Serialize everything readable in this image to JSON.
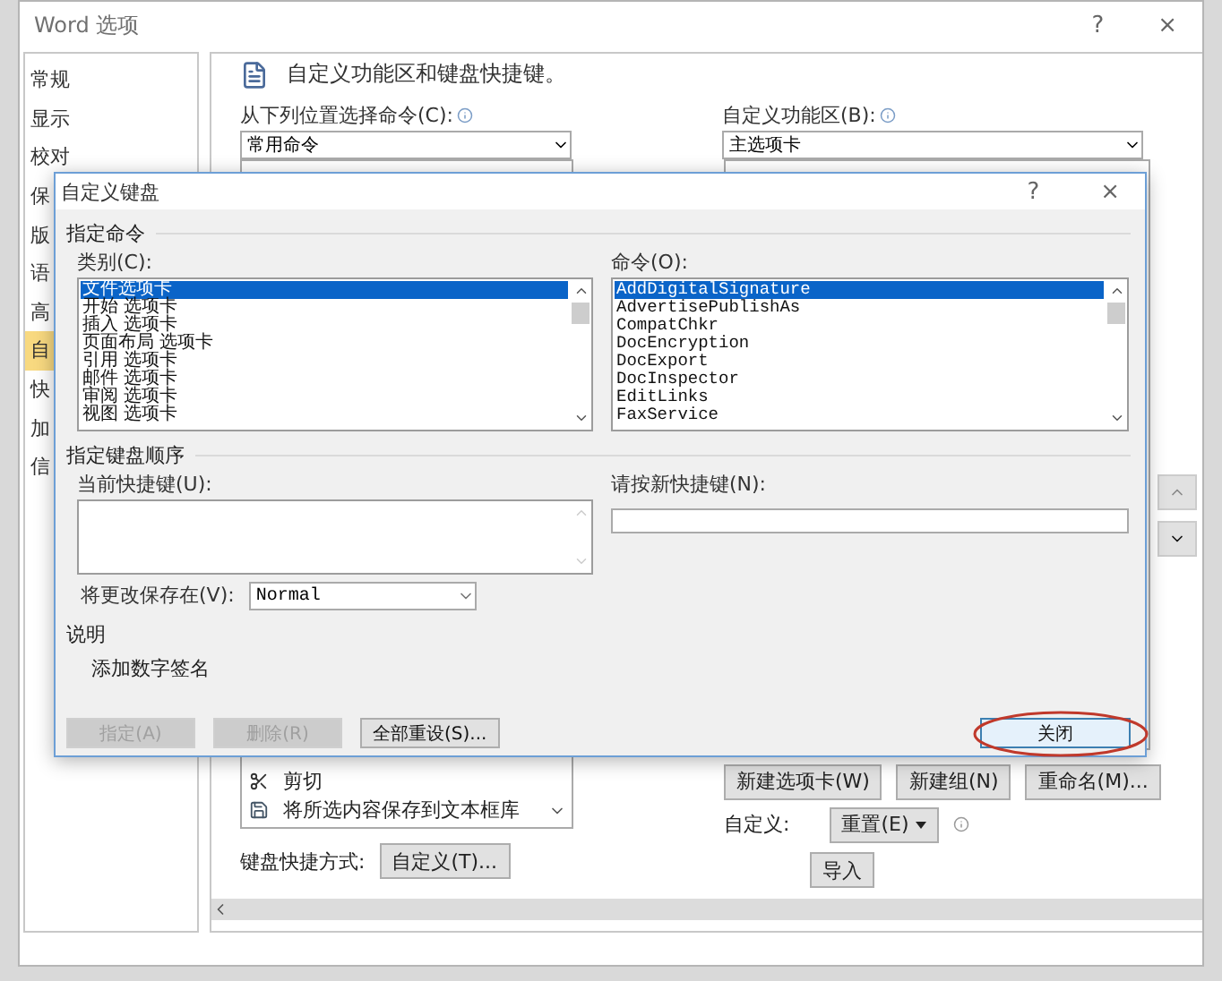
{
  "window": {
    "title": "Word 选项",
    "help": "?",
    "close": "×"
  },
  "sidebar": {
    "items": [
      {
        "label": "常规",
        "selected": false
      },
      {
        "label": "显示",
        "selected": false
      },
      {
        "label": "校对",
        "selected": false
      },
      {
        "label": "保",
        "selected": false
      },
      {
        "label": "版",
        "selected": false
      },
      {
        "label": "语",
        "selected": false
      },
      {
        "label": "高",
        "selected": false
      },
      {
        "label": "自",
        "selected": true
      },
      {
        "label": "快",
        "selected": false
      },
      {
        "label": "加",
        "selected": false
      },
      {
        "label": "信",
        "selected": false
      }
    ]
  },
  "main": {
    "heading": "自定义功能区和键盘快捷键。",
    "choose_label": "从下列位置选择命令(C):",
    "choose_value": "常用命令",
    "ribbon_label": "自定义功能区(B):",
    "ribbon_value": "主选项卡",
    "commands": [
      {
        "label": "剪切",
        "kind": "cut"
      },
      {
        "label": "将所选内容保存到文本框库",
        "kind": "save"
      }
    ],
    "keyboard_label": "键盘快捷方式:",
    "customize_button": "自定义(T)...",
    "buttons": [
      "新建选项卡(W)",
      "新建组(N)",
      "重命名(M)..."
    ],
    "custom_label": "自定义:",
    "reset_button": "重置(E)",
    "import_button": "导入"
  },
  "dialog": {
    "title": "自定义键盘",
    "help": "?",
    "close": "×",
    "command_section": "指定命令",
    "categories_label": "类别(C):",
    "categories": [
      {
        "label": "文件选项卡",
        "selected": true
      },
      {
        "label": "开始 选项卡",
        "selected": false
      },
      {
        "label": "插入 选项卡",
        "selected": false
      },
      {
        "label": "页面布局 选项卡",
        "selected": false
      },
      {
        "label": "引用 选项卡",
        "selected": false
      },
      {
        "label": "邮件 选项卡",
        "selected": false
      },
      {
        "label": "审阅 选项卡",
        "selected": false
      },
      {
        "label": "视图 选项卡",
        "selected": false
      }
    ],
    "commands_label": "命令(O):",
    "commands": [
      {
        "label": "AddDigitalSignature",
        "selected": true
      },
      {
        "label": "AdvertisePublishAs",
        "selected": false
      },
      {
        "label": "CompatChkr",
        "selected": false
      },
      {
        "label": "DocEncryption",
        "selected": false
      },
      {
        "label": "DocExport",
        "selected": false
      },
      {
        "label": "DocInspector",
        "selected": false
      },
      {
        "label": "EditLinks",
        "selected": false
      },
      {
        "label": "FaxService",
        "selected": false
      }
    ],
    "keys_section": "指定键盘顺序",
    "current_keys_label": "当前快捷键(U):",
    "new_key_label": "请按新快捷键(N):",
    "save_in_label": "将更改保存在(V):",
    "save_in_value": "Normal",
    "description_section": "说明",
    "description": "添加数字签名",
    "buttons": [
      {
        "label": "指定(A)",
        "disabled": true,
        "default": false
      },
      {
        "label": "删除(R)",
        "disabled": true,
        "default": false
      },
      {
        "label": "全部重设(S)...",
        "disabled": false,
        "default": false
      },
      {
        "label": "关闭",
        "disabled": false,
        "default": true
      }
    ]
  }
}
